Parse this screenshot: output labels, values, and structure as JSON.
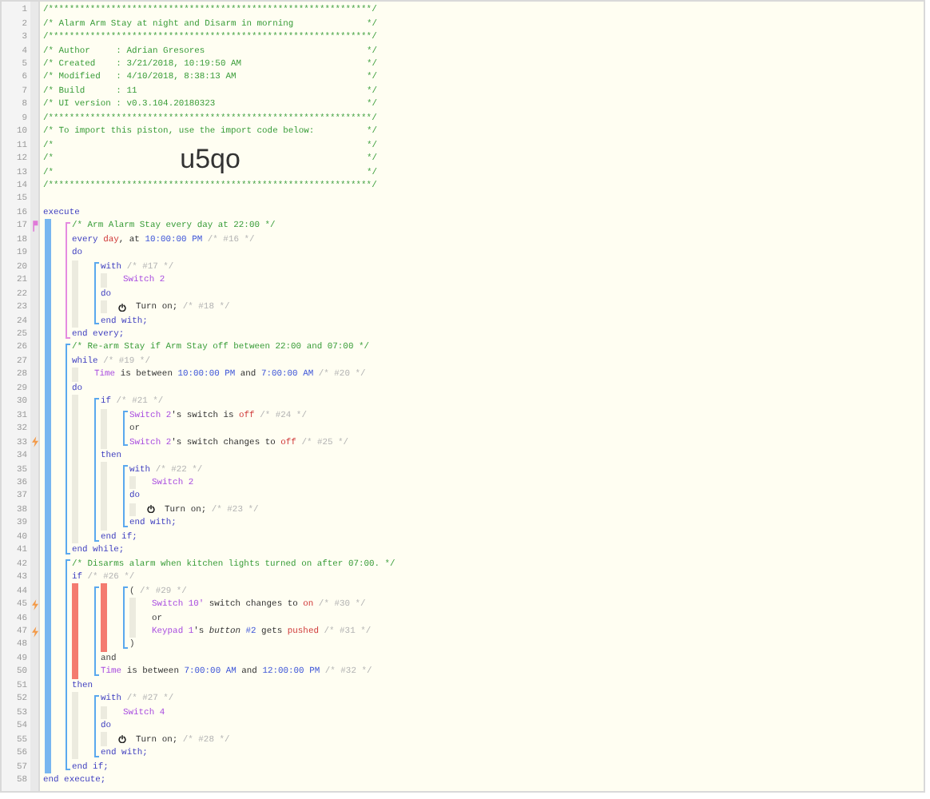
{
  "piston_code": [
    {
      "kind": "line",
      "n": "1",
      "tokens": [
        {
          "kind": "cmt",
          "text": "/**************************************************************/"
        }
      ]
    },
    {
      "kind": "banner",
      "n": "2",
      "tokens": [
        {
          "kind": "cmt",
          "text": "/* Alarm Arm Stay at night and Disarm in morning"
        }
      ],
      "end": "*/"
    },
    {
      "kind": "line",
      "n": "3",
      "tokens": [
        {
          "kind": "cmt",
          "text": "/**************************************************************/"
        }
      ]
    },
    {
      "kind": "banner",
      "n": "4",
      "tokens": [
        {
          "kind": "cmt",
          "text": "/* Author     : Adrian Gresores"
        }
      ],
      "end": "*/"
    },
    {
      "kind": "banner",
      "n": "5",
      "tokens": [
        {
          "kind": "cmt",
          "text": "/* Created    : 3/21/2018, 10:19:50 AM"
        }
      ],
      "end": "*/"
    },
    {
      "kind": "banner",
      "n": "6",
      "tokens": [
        {
          "kind": "cmt",
          "text": "/* Modified   : 4/10/2018, 8:38:13 AM"
        }
      ],
      "end": "*/"
    },
    {
      "kind": "banner",
      "n": "7",
      "tokens": [
        {
          "kind": "cmt",
          "text": "/* Build      : 11"
        }
      ],
      "end": "*/"
    },
    {
      "kind": "banner",
      "n": "8",
      "tokens": [
        {
          "kind": "cmt",
          "text": "/* UI version : v0.3.104.20180323"
        }
      ],
      "end": "*/"
    },
    {
      "kind": "line",
      "n": "9",
      "tokens": [
        {
          "kind": "cmt",
          "text": "/**************************************************************/"
        }
      ]
    },
    {
      "kind": "banner",
      "n": "10",
      "tokens": [
        {
          "kind": "cmt",
          "text": "/* To import this piston, use the import code below:"
        }
      ],
      "end": "*/"
    },
    {
      "kind": "banner",
      "n": "11",
      "tokens": [
        {
          "kind": "cmt",
          "text": "/*"
        }
      ],
      "end": "*/"
    },
    {
      "kind": "banner",
      "n": "12",
      "tokens": [
        {
          "kind": "cmt",
          "text": "/*"
        },
        {
          "kind": "code",
          "text": "u5qo"
        }
      ],
      "end": "*/"
    },
    {
      "kind": "banner",
      "n": "13",
      "tokens": [
        {
          "kind": "cmt",
          "text": "/*"
        }
      ],
      "end": "*/"
    },
    {
      "kind": "line",
      "n": "14",
      "tokens": [
        {
          "kind": "cmt",
          "text": "/**************************************************************/"
        }
      ]
    },
    {
      "kind": "line",
      "n": "15"
    },
    {
      "kind": "line",
      "n": "16",
      "tokens": [
        {
          "kind": "kw",
          "text": "execute"
        }
      ]
    },
    {
      "kind": "execute",
      "children": [
        {
          "kind": "statement",
          "highlighted": true,
          "children": [
            {
              "kind": "line",
              "n": "17",
              "marker": {
                "kind": "timer"
              },
              "tokens": [
                {
                  "kind": "cmt",
                  "text": "/* Arm Alarm Stay every day at 22:00 */"
                }
              ]
            },
            {
              "kind": "line",
              "n": "18",
              "tokens": [
                {
                  "kind": "kw",
                  "text": "every"
                },
                {
                  "kind": "red",
                  "text": " day"
                },
                {
                  "kind": "txt",
                  "text": ", at "
                },
                {
                  "kind": "val",
                  "text": "10:00:00 PM"
                },
                {
                  "kind": "ref",
                  "text": " /* #16 */"
                }
              ]
            },
            {
              "kind": "line",
              "n": "19",
              "tokens": [
                {
                  "kind": "kw",
                  "text": "do"
                }
              ]
            },
            {
              "kind": "body",
              "children": [
                {
                  "kind": "statement",
                  "highlighted": false,
                  "children": [
                    {
                      "kind": "line",
                      "n": "20",
                      "tokens": [
                        {
                          "kind": "kw",
                          "text": "with"
                        },
                        {
                          "kind": "ref",
                          "text": " /* #17 */"
                        }
                      ]
                    },
                    {
                      "kind": "body",
                      "children": [
                        {
                          "kind": "line",
                          "n": "21",
                          "tokens": [
                            {
                              "kind": "dev",
                              "text": "Switch 2"
                            }
                          ]
                        }
                      ]
                    },
                    {
                      "kind": "line",
                      "n": "22",
                      "tokens": [
                        {
                          "kind": "kw",
                          "text": "do"
                        }
                      ]
                    },
                    {
                      "kind": "body",
                      "children": [
                        {
                          "kind": "action",
                          "n": "23",
                          "tokens": [
                            {
                              "kind": "txt",
                              "text": "Turn on;"
                            },
                            {
                              "kind": "ref",
                              "text": " /* #18 */"
                            }
                          ]
                        }
                      ]
                    },
                    {
                      "kind": "line",
                      "n": "24",
                      "tokens": [
                        {
                          "kind": "kw",
                          "text": "end with;"
                        }
                      ]
                    }
                  ]
                }
              ]
            },
            {
              "kind": "line",
              "n": "25",
              "tokens": [
                {
                  "kind": "kw",
                  "text": "end every;"
                }
              ]
            }
          ]
        },
        {
          "kind": "statement",
          "highlighted": false,
          "children": [
            {
              "kind": "line",
              "n": "26",
              "tokens": [
                {
                  "kind": "cmt",
                  "text": "/* Re-arm Stay if Arm Stay off between 22:00 and 07:00 */"
                }
              ]
            },
            {
              "kind": "line",
              "n": "27",
              "tokens": [
                {
                  "kind": "kw",
                  "text": "while"
                },
                {
                  "kind": "ref",
                  "text": " /* #19 */"
                }
              ]
            },
            {
              "kind": "body",
              "children": [
                {
                  "kind": "line",
                  "n": "28",
                  "tokens": [
                    {
                      "kind": "dev",
                      "text": "Time"
                    },
                    {
                      "kind": "txt",
                      "text": " is between "
                    },
                    {
                      "kind": "val",
                      "text": "10:00:00 PM"
                    },
                    {
                      "kind": "txt",
                      "text": " and "
                    },
                    {
                      "kind": "val",
                      "text": "7:00:00 AM"
                    },
                    {
                      "kind": "ref",
                      "text": " /* #20 */"
                    }
                  ]
                }
              ]
            },
            {
              "kind": "line",
              "n": "29",
              "tokens": [
                {
                  "kind": "kw",
                  "text": "do"
                }
              ]
            },
            {
              "kind": "body",
              "children": [
                {
                  "kind": "statement",
                  "highlighted": false,
                  "children": [
                    {
                      "kind": "line",
                      "n": "30",
                      "tokens": [
                        {
                          "kind": "kw",
                          "text": "if"
                        },
                        {
                          "kind": "ref",
                          "text": " /* #21 */"
                        }
                      ]
                    },
                    {
                      "kind": "body",
                      "children": [
                        {
                          "kind": "statement",
                          "highlighted": false,
                          "children": [
                            {
                              "kind": "line",
                              "n": "31",
                              "tokens": [
                                {
                                  "kind": "dev",
                                  "text": "Switch 2"
                                },
                                {
                                  "kind": "txt",
                                  "text": "'s switch is "
                                },
                                {
                                  "kind": "red",
                                  "text": "off"
                                },
                                {
                                  "kind": "ref",
                                  "text": " /* #24 */"
                                }
                              ]
                            },
                            {
                              "kind": "line",
                              "n": "32",
                              "tokens": [
                                {
                                  "kind": "op",
                                  "text": "or"
                                }
                              ]
                            },
                            {
                              "kind": "line",
                              "n": "33",
                              "marker": {
                                "kind": "trigger"
                              },
                              "tokens": [
                                {
                                  "kind": "dev",
                                  "text": "Switch 2"
                                },
                                {
                                  "kind": "txt",
                                  "text": "'s switch changes to "
                                },
                                {
                                  "kind": "red",
                                  "text": "off"
                                },
                                {
                                  "kind": "ref",
                                  "text": " /* #25 */"
                                }
                              ]
                            }
                          ]
                        }
                      ]
                    },
                    {
                      "kind": "line",
                      "n": "34",
                      "tokens": [
                        {
                          "kind": "kw",
                          "text": "then"
                        }
                      ]
                    },
                    {
                      "kind": "body",
                      "children": [
                        {
                          "kind": "statement",
                          "highlighted": false,
                          "children": [
                            {
                              "kind": "line",
                              "n": "35",
                              "tokens": [
                                {
                                  "kind": "kw",
                                  "text": "with"
                                },
                                {
                                  "kind": "ref",
                                  "text": " /* #22 */"
                                }
                              ]
                            },
                            {
                              "kind": "body",
                              "children": [
                                {
                                  "kind": "line",
                                  "n": "36",
                                  "tokens": [
                                    {
                                      "kind": "dev",
                                      "text": "Switch 2"
                                    }
                                  ]
                                }
                              ]
                            },
                            {
                              "kind": "line",
                              "n": "37",
                              "tokens": [
                                {
                                  "kind": "kw",
                                  "text": "do"
                                }
                              ]
                            },
                            {
                              "kind": "body",
                              "children": [
                                {
                                  "kind": "action",
                                  "n": "38",
                                  "tokens": [
                                    {
                                      "kind": "txt",
                                      "text": "Turn on;"
                                    },
                                    {
                                      "kind": "ref",
                                      "text": " /* #23 */"
                                    }
                                  ]
                                }
                              ]
                            },
                            {
                              "kind": "line",
                              "n": "39",
                              "tokens": [
                                {
                                  "kind": "kw",
                                  "text": "end with;"
                                }
                              ]
                            }
                          ]
                        }
                      ]
                    },
                    {
                      "kind": "line",
                      "n": "40",
                      "tokens": [
                        {
                          "kind": "kw",
                          "text": "end if;"
                        }
                      ]
                    }
                  ]
                }
              ]
            },
            {
              "kind": "line",
              "n": "41",
              "tokens": [
                {
                  "kind": "kw",
                  "text": "end while;"
                }
              ]
            }
          ]
        },
        {
          "kind": "statement",
          "highlighted": false,
          "children": [
            {
              "kind": "line",
              "n": "42",
              "tokens": [
                {
                  "kind": "cmt",
                  "text": "/* Disarms alarm when kitchen lights turned on after 07:00. */"
                }
              ]
            },
            {
              "kind": "line",
              "n": "43",
              "tokens": [
                {
                  "kind": "kw",
                  "text": "if"
                },
                {
                  "kind": "ref",
                  "text": " /* #26 */"
                }
              ]
            },
            {
              "kind": "failed",
              "children": [
                {
                  "kind": "statement",
                  "highlighted": false,
                  "children": [
                    {
                      "kind": "failed",
                      "children": [
                        {
                          "kind": "statement",
                          "highlighted": false,
                          "children": [
                            {
                              "kind": "line",
                              "n": "44",
                              "tokens": [
                                {
                                  "kind": "op",
                                  "text": "("
                                },
                                {
                                  "kind": "ref",
                                  "text": " /* #29 */"
                                }
                              ]
                            },
                            {
                              "kind": "body",
                              "children": [
                                {
                                  "kind": "line",
                                  "n": "45",
                                  "marker": {
                                    "kind": "trigger"
                                  },
                                  "tokens": [
                                    {
                                      "kind": "dev",
                                      "text": "Switch 10'"
                                    },
                                    {
                                      "kind": "txt",
                                      "text": " switch changes to "
                                    },
                                    {
                                      "kind": "red",
                                      "text": "on"
                                    },
                                    {
                                      "kind": "ref",
                                      "text": " /* #30 */"
                                    }
                                  ]
                                },
                                {
                                  "kind": "line",
                                  "n": "46",
                                  "tokens": [
                                    {
                                      "kind": "op",
                                      "text": "or"
                                    }
                                  ]
                                },
                                {
                                  "kind": "line",
                                  "n": "47",
                                  "marker": {
                                    "kind": "trigger"
                                  },
                                  "tokens": [
                                    {
                                      "kind": "dev",
                                      "text": "Keypad 1"
                                    },
                                    {
                                      "kind": "txt",
                                      "text": "'s "
                                    },
                                    {
                                      "kind": "em",
                                      "text": "button"
                                    },
                                    {
                                      "kind": "val",
                                      "text": " #2"
                                    },
                                    {
                                      "kind": "txt",
                                      "text": " gets "
                                    },
                                    {
                                      "kind": "red",
                                      "text": "pushed"
                                    },
                                    {
                                      "kind": "ref",
                                      "text": " /* #31 */"
                                    }
                                  ]
                                }
                              ]
                            },
                            {
                              "kind": "line",
                              "n": "48",
                              "tokens": [
                                {
                                  "kind": "op",
                                  "text": ")"
                                }
                              ]
                            }
                          ]
                        }
                      ]
                    },
                    {
                      "kind": "line",
                      "n": "49",
                      "tokens": [
                        {
                          "kind": "op",
                          "text": "and"
                        }
                      ]
                    },
                    {
                      "kind": "line",
                      "n": "50",
                      "tokens": [
                        {
                          "kind": "dev",
                          "text": "Time"
                        },
                        {
                          "kind": "txt",
                          "text": " is between "
                        },
                        {
                          "kind": "val",
                          "text": "7:00:00 AM"
                        },
                        {
                          "kind": "txt",
                          "text": " and "
                        },
                        {
                          "kind": "val",
                          "text": "12:00:00 PM"
                        },
                        {
                          "kind": "ref",
                          "text": " /* #32 */"
                        }
                      ]
                    }
                  ]
                }
              ]
            },
            {
              "kind": "line",
              "n": "51",
              "tokens": [
                {
                  "kind": "kw",
                  "text": "then"
                }
              ]
            },
            {
              "kind": "body",
              "children": [
                {
                  "kind": "statement",
                  "highlighted": false,
                  "children": [
                    {
                      "kind": "line",
                      "n": "52",
                      "tokens": [
                        {
                          "kind": "kw",
                          "text": "with"
                        },
                        {
                          "kind": "ref",
                          "text": " /* #27 */"
                        }
                      ]
                    },
                    {
                      "kind": "body",
                      "children": [
                        {
                          "kind": "line",
                          "n": "53",
                          "tokens": [
                            {
                              "kind": "dev",
                              "text": "Switch 4"
                            }
                          ]
                        }
                      ]
                    },
                    {
                      "kind": "line",
                      "n": "54",
                      "tokens": [
                        {
                          "kind": "kw",
                          "text": "do"
                        }
                      ]
                    },
                    {
                      "kind": "body",
                      "children": [
                        {
                          "kind": "action",
                          "n": "55",
                          "tokens": [
                            {
                              "kind": "txt",
                              "text": "Turn on;"
                            },
                            {
                              "kind": "ref",
                              "text": " /* #28 */"
                            }
                          ]
                        }
                      ]
                    },
                    {
                      "kind": "line",
                      "n": "56",
                      "tokens": [
                        {
                          "kind": "kw",
                          "text": "end with;"
                        }
                      ]
                    }
                  ]
                }
              ]
            },
            {
              "kind": "line",
              "n": "57",
              "tokens": [
                {
                  "kind": "kw",
                  "text": "end if;"
                }
              ]
            }
          ]
        }
      ]
    },
    {
      "kind": "line",
      "n": "58",
      "tokens": [
        {
          "kind": "kw",
          "text": "end execute;"
        }
      ]
    }
  ]
}
